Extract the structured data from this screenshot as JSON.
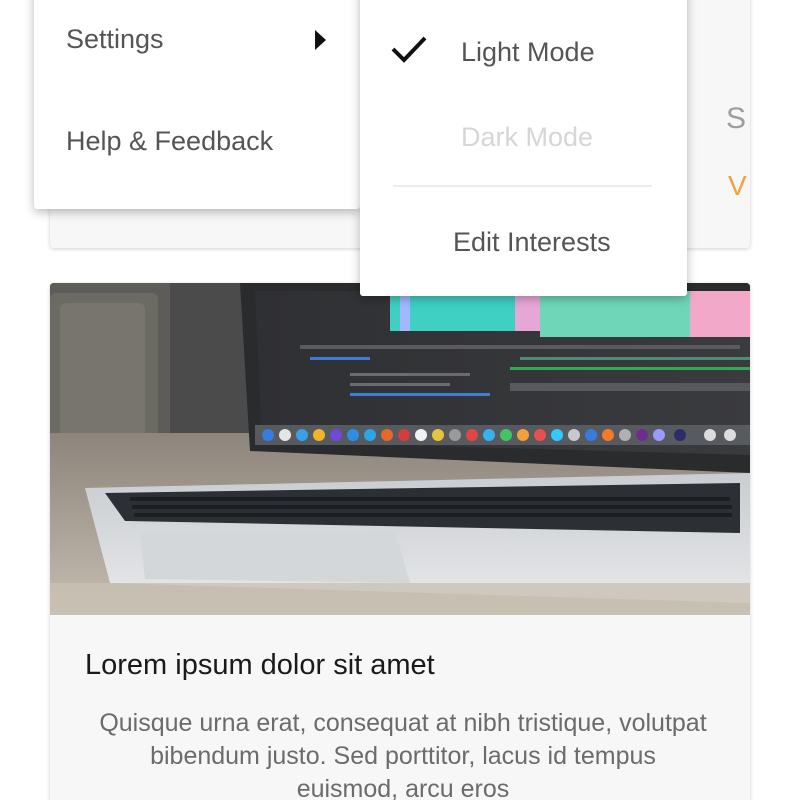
{
  "menu": {
    "items": [
      {
        "label": "Settings",
        "has_submenu": true,
        "icon": "chevron-right-icon"
      },
      {
        "label": "Help & Feedback"
      }
    ]
  },
  "submenu": {
    "items": [
      {
        "label": "Light Mode",
        "checked": true,
        "icon": "check-icon"
      },
      {
        "label": "Dark Mode",
        "disabled": true
      },
      {
        "label": "Edit Interests"
      }
    ]
  },
  "background_card": {
    "peek_text": "S",
    "peek_link": "V"
  },
  "article": {
    "image_alt": "Laptop on a desk",
    "title": "Lorem ipsum dolor sit amet",
    "body": "Quisque urna erat, consequat at nibh tristique, volutpat bibendum justo. Sed porttitor, lacus id tempus euismod, arcu eros"
  },
  "colors": {
    "accent": "#f5a03a",
    "menu_text": "#555555",
    "disabled_text": "#d6d6d6",
    "card_bg": "#f7f7f7"
  }
}
